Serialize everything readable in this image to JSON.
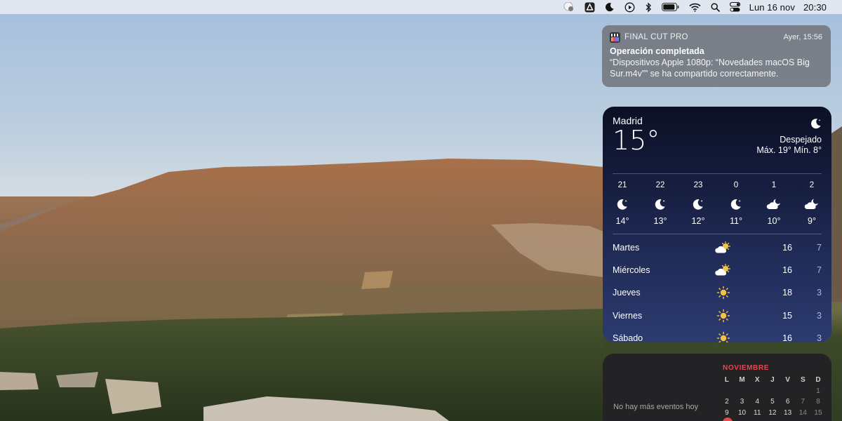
{
  "menubar": {
    "date": "Lun 16 nov",
    "time": "20:30",
    "icons": [
      "user-badge-icon",
      "drive-icon",
      "moon-icon",
      "play-circle-icon",
      "bluetooth-icon",
      "battery-icon",
      "wifi-icon",
      "search-icon",
      "control-center-icon"
    ]
  },
  "notification": {
    "app": "FINAL CUT PRO",
    "time": "Ayer, 15:56",
    "title": "Operación completada",
    "body": "“Dispositivos Apple 1080p: “Novedades macOS Big Sur.m4v”” se ha compartido correctamente."
  },
  "weather": {
    "city": "Madrid",
    "temp": "15°",
    "condition": "Despejado",
    "hilo": "Máx. 19° Mín. 8°",
    "hourly": [
      {
        "hour": "21",
        "icon": "moon-icon",
        "temp": "14°"
      },
      {
        "hour": "22",
        "icon": "moon-icon",
        "temp": "13°"
      },
      {
        "hour": "23",
        "icon": "moon-icon",
        "temp": "12°"
      },
      {
        "hour": "0",
        "icon": "moon-icon",
        "temp": "11°"
      },
      {
        "hour": "1",
        "icon": "cloud-moon-icon",
        "temp": "10°"
      },
      {
        "hour": "2",
        "icon": "cloud-moon-icon",
        "temp": "9°"
      }
    ],
    "daily": [
      {
        "day": "Martes",
        "icon": "partly-cloudy-icon",
        "max": "16",
        "min": "7"
      },
      {
        "day": "Miércoles",
        "icon": "partly-cloudy-icon",
        "max": "16",
        "min": "7"
      },
      {
        "day": "Jueves",
        "icon": "sun-icon",
        "max": "18",
        "min": "3"
      },
      {
        "day": "Viernes",
        "icon": "sun-icon",
        "max": "15",
        "min": "3"
      },
      {
        "day": "Sábado",
        "icon": "sun-icon",
        "max": "16",
        "min": "3"
      }
    ]
  },
  "calendar": {
    "month": "NOVIEMBRE",
    "empty_text": "No hay más eventos hoy",
    "weekdays": [
      "L",
      "M",
      "X",
      "J",
      "V",
      "S",
      "D"
    ],
    "weeks": [
      [
        "",
        "",
        "",
        "",
        "",
        "",
        "1"
      ],
      [
        "2",
        "3",
        "4",
        "5",
        "6",
        "7",
        "8"
      ],
      [
        "9",
        "10",
        "11",
        "12",
        "13",
        "14",
        "15"
      ]
    ],
    "today_color": "#e5484d"
  }
}
